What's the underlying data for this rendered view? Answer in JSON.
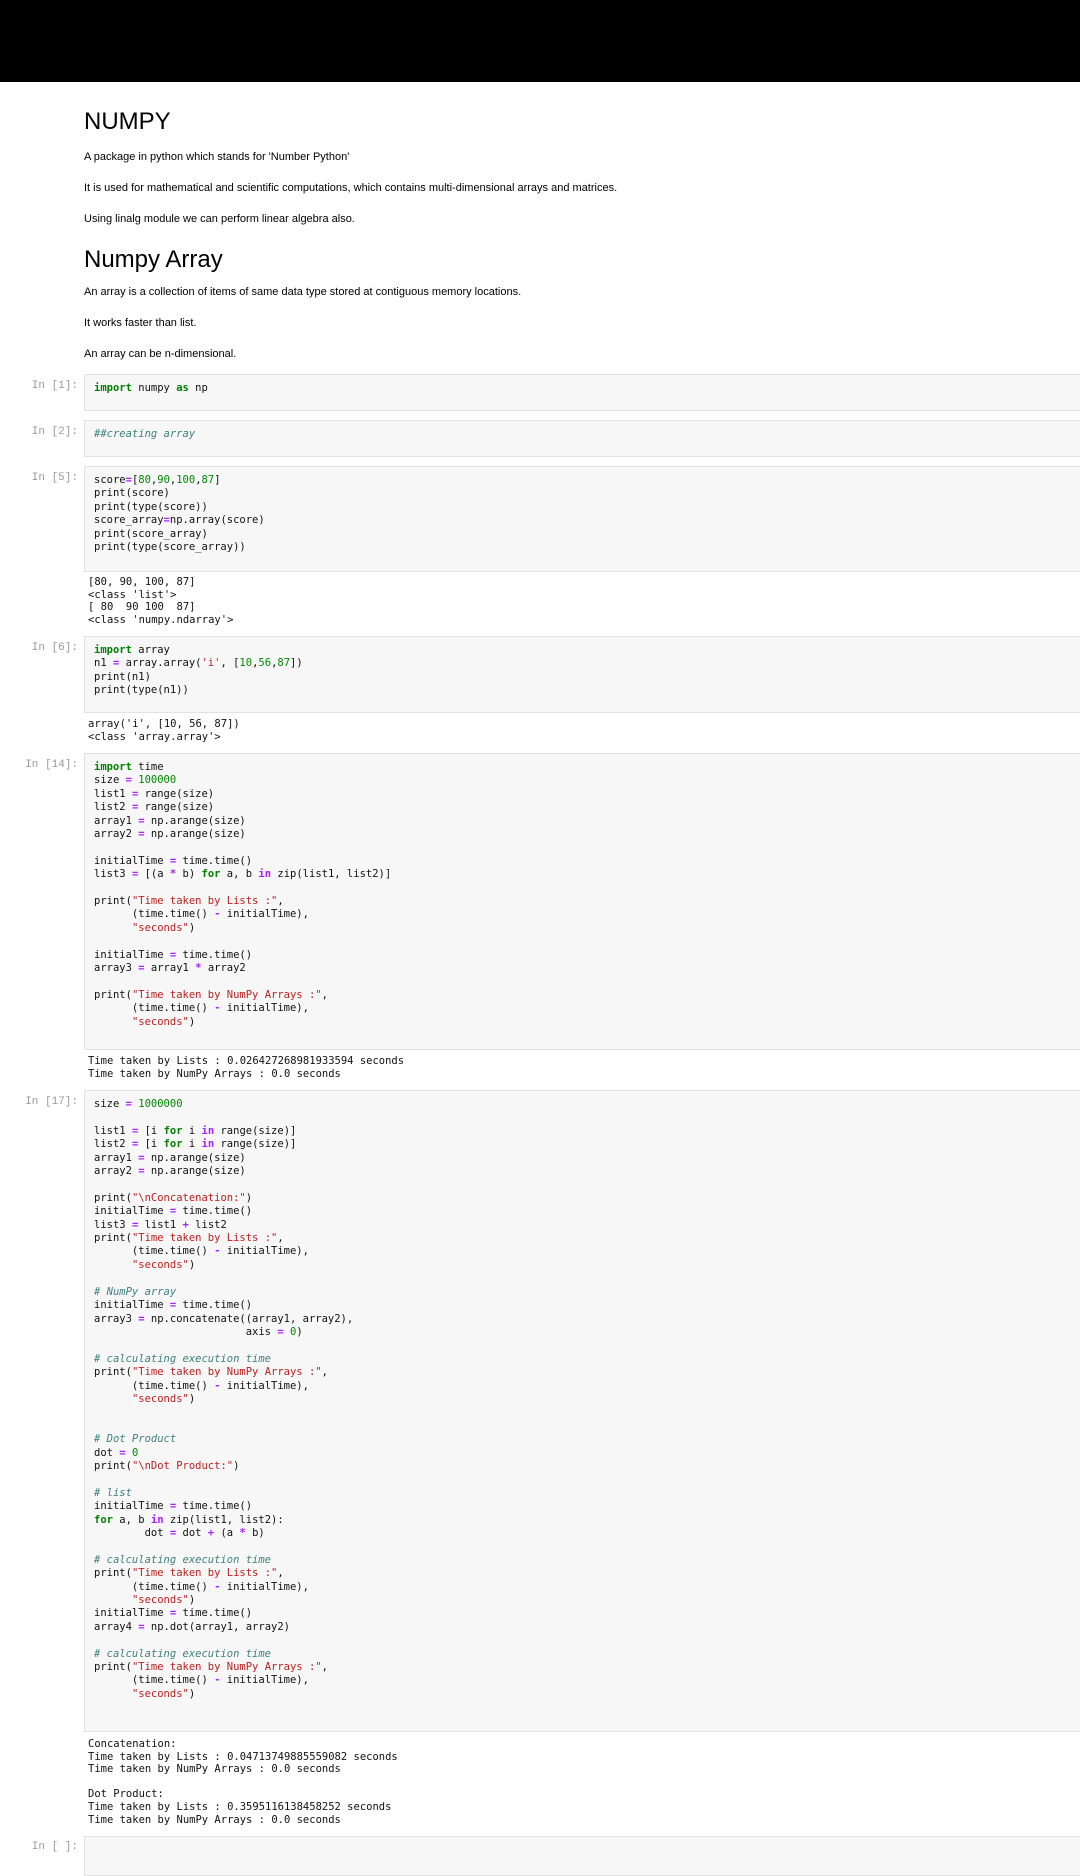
{
  "markdown": {
    "title": "NUMPY",
    "intro": [
      "A package in python which stands for 'Number Python'",
      "It is used for mathematical and scientific computations, which contains multi-dimensional arrays and matrices.",
      "Using linalg module we can perform linear algebra also."
    ],
    "subtitle": "Numpy Array",
    "array_desc": [
      "An array is a collection of items of same data type stored at contiguous memory locations.",
      "It works faster than list.",
      "An array can be n-dimensional."
    ]
  },
  "cells": [
    {
      "prompt": "In [1]:",
      "source": "import numpy as np",
      "output": ""
    },
    {
      "prompt": "In [2]:",
      "source": "##creating array",
      "output": ""
    },
    {
      "prompt": "In [5]:",
      "source": "score=[80,90,100,87]\nprint(score)\nprint(type(score))\nscore_array=np.array(score)\nprint(score_array)\nprint(type(score_array))",
      "output": "[80, 90, 100, 87]\n<class 'list'>\n[ 80  90 100  87]\n<class 'numpy.ndarray'>"
    },
    {
      "prompt": "In [6]:",
      "source": "import array\nn1 = array.array('i', [10,56,87])\nprint(n1)\nprint(type(n1))",
      "output": "array('i', [10, 56, 87])\n<class 'array.array'>"
    },
    {
      "prompt": "In [14]:",
      "source": "import time\nsize = 100000\nlist1 = range(size)\nlist2 = range(size)\narray1 = np.arange(size)\narray2 = np.arange(size)\n\ninitialTime = time.time()\nlist3 = [(a * b) for a, b in zip(list1, list2)]\n\nprint(\"Time taken by Lists :\",\n      (time.time() - initialTime),\n      \"seconds\")\n\ninitialTime = time.time()\narray3 = array1 * array2\n\nprint(\"Time taken by NumPy Arrays :\",\n      (time.time() - initialTime),\n      \"seconds\")",
      "output": "Time taken by Lists : 0.026427268981933594 seconds\nTime taken by NumPy Arrays : 0.0 seconds"
    },
    {
      "prompt": "In [17]:",
      "source": "size = 1000000\n\nlist1 = [i for i in range(size)]\nlist2 = [i for i in range(size)]\narray1 = np.arange(size)\narray2 = np.arange(size)\n\nprint(\"\\nConcatenation:\")\ninitialTime = time.time()\nlist3 = list1 + list2\nprint(\"Time taken by Lists :\",\n      (time.time() - initialTime),\n      \"seconds\")\n\n# NumPy array\ninitialTime = time.time()\narray3 = np.concatenate((array1, array2),\n                        axis = 0)\n\n# calculating execution time\nprint(\"Time taken by NumPy Arrays :\",\n      (time.time() - initialTime),\n      \"seconds\")\n\n\n# Dot Product\ndot = 0\nprint(\"\\nDot Product:\")\n\n# list\ninitialTime = time.time()\nfor a, b in zip(list1, list2):\n        dot = dot + (a * b)\n\n# calculating execution time\nprint(\"Time taken by Lists :\",\n      (time.time() - initialTime),\n      \"seconds\")\ninitialTime = time.time()\narray4 = np.dot(array1, array2)\n\n# calculating execution time\nprint(\"Time taken by NumPy Arrays :\",\n      (time.time() - initialTime),\n      \"seconds\")",
      "output": "Concatenation:\nTime taken by Lists : 0.04713749885559082 seconds\nTime taken by NumPy Arrays : 0.0 seconds\n\nDot Product:\nTime taken by Lists : 0.3595116138458252 seconds\nTime taken by NumPy Arrays : 0.0 seconds"
    },
    {
      "prompt": "In [ ]:",
      "source": "",
      "output": ""
    }
  ]
}
